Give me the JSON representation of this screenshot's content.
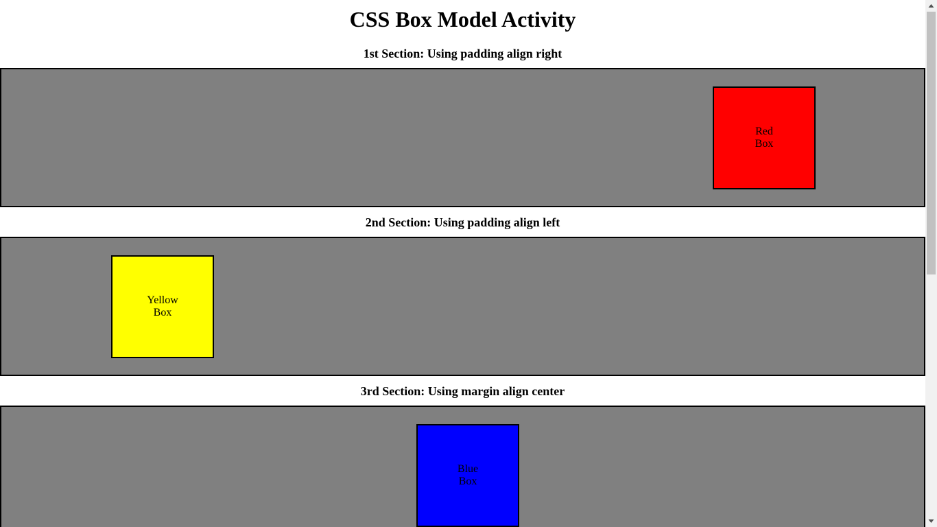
{
  "page": {
    "title": "CSS Box Model Activity"
  },
  "sections": [
    {
      "heading": "1st Section: Using padding align right",
      "background": "#808080",
      "box": {
        "line1": "Red",
        "line2": "Box",
        "color": "#ff0000"
      }
    },
    {
      "heading": "2nd Section: Using padding align left",
      "background": "#808080",
      "box": {
        "line1": "Yellow",
        "line2": "Box",
        "color": "#ffff00"
      }
    },
    {
      "heading": "3rd Section: Using margin align center",
      "background": "#808080",
      "box": {
        "line1": "Blue",
        "line2": "Box",
        "color": "#0000ff"
      }
    }
  ],
  "icons": {
    "scroll_up": "scroll-up-arrow-icon",
    "scroll_down": "scroll-down-arrow-icon"
  }
}
